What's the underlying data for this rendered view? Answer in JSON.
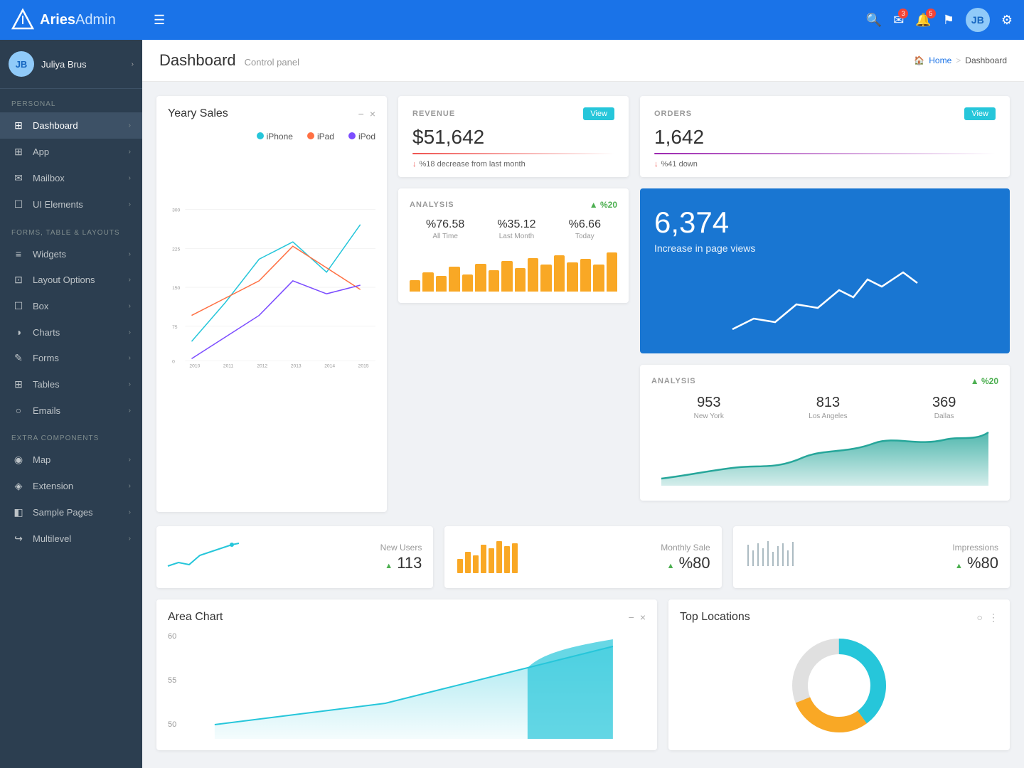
{
  "app": {
    "brand_aries": "Aries",
    "brand_admin": "Admin",
    "logo_alt": "Aries Logo"
  },
  "topnav": {
    "hamburger_icon": "☰",
    "search_icon": "🔍",
    "mail_icon": "✉",
    "mail_badge": "3",
    "bell_icon": "🔔",
    "bell_badge": "5",
    "flag_icon": "⚑",
    "settings_icon": "⚙",
    "avatar_initials": "JB"
  },
  "sidebar": {
    "user_name": "Juliya Brus",
    "user_initials": "JB",
    "personal_label": "PERSONAL",
    "items_personal": [
      {
        "label": "Dashboard",
        "icon": "⊞",
        "active": true
      },
      {
        "label": "App",
        "icon": "⊞"
      },
      {
        "label": "Mailbox",
        "icon": "✉"
      },
      {
        "label": "UI Elements",
        "icon": "☐"
      }
    ],
    "forms_label": "FORMS, TABLE & LAYOUTS",
    "items_forms": [
      {
        "label": "Widgets",
        "icon": "≡"
      },
      {
        "label": "Layout Options",
        "icon": "⊡"
      },
      {
        "label": "Box",
        "icon": "☐"
      },
      {
        "label": "Charts",
        "icon": "◑"
      },
      {
        "label": "Forms",
        "icon": "✎"
      },
      {
        "label": "Tables",
        "icon": "⊞"
      },
      {
        "label": "Emails",
        "icon": "○"
      }
    ],
    "extra_label": "EXTRA COMPONENTS",
    "items_extra": [
      {
        "label": "Map",
        "icon": "◉"
      },
      {
        "label": "Extension",
        "icon": "◈"
      },
      {
        "label": "Sample Pages",
        "icon": "◧"
      },
      {
        "label": "Multilevel",
        "icon": "↪"
      }
    ]
  },
  "header": {
    "page_title": "Dashboard",
    "page_subtitle": "Control panel",
    "breadcrumb_home": "Home",
    "breadcrumb_separator": ">",
    "breadcrumb_current": "Dashboard",
    "home_icon": "🏠"
  },
  "revenue": {
    "label": "REVENUE",
    "value": "$51,642",
    "view_btn": "View",
    "change_text": "%18 decrease from last month",
    "change_direction": "down"
  },
  "orders": {
    "label": "ORDERS",
    "value": "1,642",
    "view_btn": "View",
    "change_text": "%41 down",
    "change_direction": "down"
  },
  "analysis_top": {
    "label": "ANALYSIS",
    "badge": "▲ %20",
    "stats": [
      {
        "value": "%76.58",
        "label": "All Time"
      },
      {
        "value": "%35.12",
        "label": "Last Month"
      },
      {
        "value": "%6.66",
        "label": "Today"
      }
    ],
    "bars": [
      20,
      35,
      28,
      45,
      30,
      50,
      38,
      55,
      42,
      60,
      48,
      65,
      52,
      58,
      48,
      70
    ]
  },
  "page_views": {
    "value": "6,374",
    "label": "Increase in page views"
  },
  "analysis_bottom": {
    "label": "ANALYSIS",
    "badge": "▲ %20",
    "stats": [
      {
        "value": "953",
        "label": "New York"
      },
      {
        "value": "813",
        "label": "Los Angeles"
      },
      {
        "value": "369",
        "label": "Dallas"
      }
    ]
  },
  "yearly_sales": {
    "title": "Yeary Sales",
    "legend": [
      {
        "label": "iPhone",
        "color": "#26c6da"
      },
      {
        "label": "iPad",
        "color": "#ff7043"
      },
      {
        "label": "iPod",
        "color": "#7c4dff"
      }
    ],
    "y_labels": [
      "300",
      "225",
      "150",
      "75",
      "0"
    ],
    "x_labels": [
      "2010",
      "2011",
      "2012",
      "2013",
      "2014",
      "2015"
    ],
    "minimize_btn": "−",
    "close_btn": "×"
  },
  "new_users": {
    "label": "New Users",
    "value": "113",
    "change": "▲"
  },
  "monthly_sale": {
    "label": "Monthly Sale",
    "value": "%80",
    "change": "▲"
  },
  "impressions": {
    "label": "Impressions",
    "value": "%80",
    "change": "▲"
  },
  "area_chart": {
    "title": "Area Chart",
    "minimize_btn": "−",
    "close_btn": "×",
    "y_labels": [
      "60",
      "55",
      "50"
    ]
  },
  "top_locations": {
    "title": "Top Locations",
    "circle_btn": "○",
    "more_btn": "⋮"
  }
}
